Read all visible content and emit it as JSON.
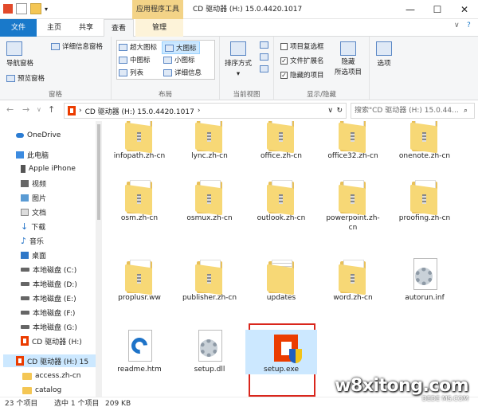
{
  "titlebar": {
    "context_tab": "应用程序工具",
    "title": "CD 驱动器 (H:) 15.0.4420.1017",
    "minimize": "—",
    "maximize": "☐",
    "close": "✕"
  },
  "tabs": {
    "file": "文件",
    "home": "主页",
    "share": "共享",
    "view": "查看",
    "manage": "管理"
  },
  "ribbon": {
    "nav_pane": "导航窗格",
    "preview_pane": "预览窗格",
    "details_pane": "详细信息窗格",
    "pane_group": "窗格",
    "layout": {
      "xl_icons": "超大图标",
      "large_icons": "大图标",
      "medium_icons": "中图标",
      "small_icons": "小图标",
      "list": "列表",
      "details": "详细信息",
      "group": "布局"
    },
    "sort_by": "排序方式",
    "current_view_group": "当前视图",
    "item_checkboxes": "项目复选框",
    "file_extensions": "文件扩展名",
    "hidden_items": "隐藏的项目",
    "hide_selected": "隐藏所选项目",
    "hide_label_1": "隐藏",
    "hide_label_2": "所选项目",
    "show_hide_group": "显示/隐藏",
    "options": "选项"
  },
  "address": {
    "path": "CD 驱动器 (H:) 15.0.4420.1017",
    "search_placeholder": "搜索\"CD 驱动器 (H:) 15.0.44..."
  },
  "nav": {
    "items": [
      "OneDrive",
      "此电脑",
      "Apple iPhone",
      "视频",
      "图片",
      "文档",
      "下载",
      "音乐",
      "桌面",
      "本地磁盘 (C:)",
      "本地磁盘 (D:)",
      "本地磁盘 (E:)",
      "本地磁盘 (F:)",
      "本地磁盘 (G:)",
      "CD 驱动器 (H:)",
      "CD 驱动器 (H:) 15",
      "access.zh-cn",
      "catalog"
    ]
  },
  "files": [
    "infopath.zh-cn",
    "lync.zh-cn",
    "office.zh-cn",
    "office32.zh-cn",
    "onenote.zh-cn",
    "osm.zh-cn",
    "osmux.zh-cn",
    "outlook.zh-cn",
    "powerpoint.zh-cn",
    "proofing.zh-cn",
    "proplusr.ww",
    "publisher.zh-cn",
    "updates",
    "word.zh-cn",
    "autorun.inf",
    "readme.htm",
    "setup.dll",
    "setup.exe"
  ],
  "status": {
    "count": "23 个项目",
    "selected": "选中 1 个项目",
    "size": "209 KB"
  },
  "watermark": {
    "main": "w8xitong.com",
    "sub": "DEDE MS.COM"
  },
  "colors": {
    "file_tab": "#1979ca",
    "context_tab": "#f3d387",
    "selection": "#cce8ff",
    "highlight_box": "#d9261c",
    "folder": "#f4c654"
  }
}
